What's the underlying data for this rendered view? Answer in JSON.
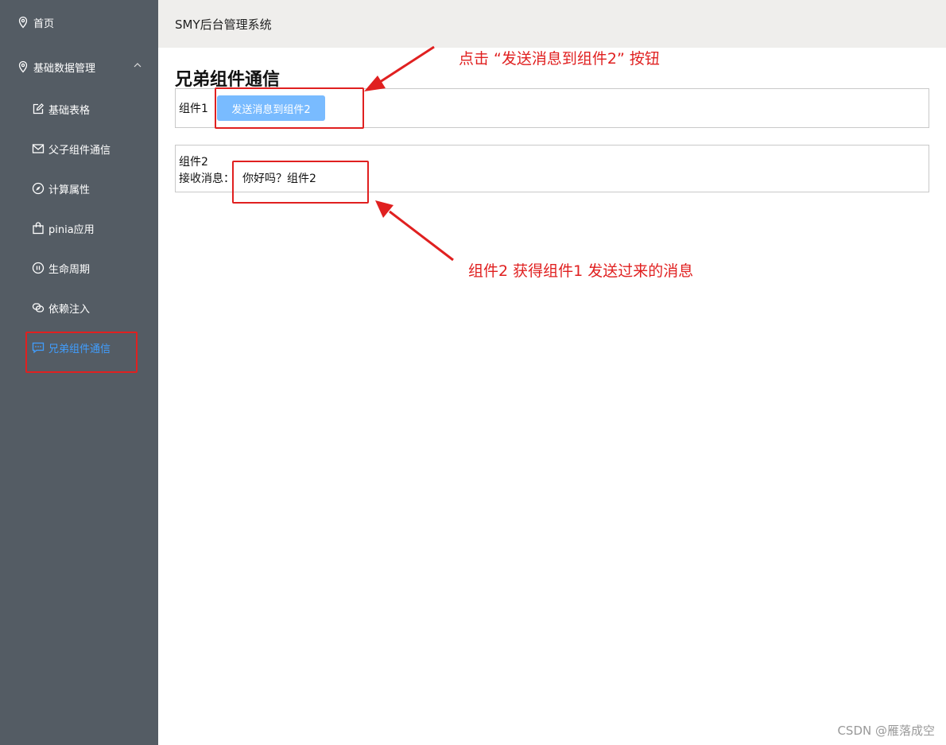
{
  "header": {
    "title": "SMY后台管理系统"
  },
  "sidebar": {
    "items": [
      {
        "label": "首页",
        "icon": "location-icon"
      },
      {
        "label": "基础数据管理",
        "icon": "location-icon",
        "expanded": true
      }
    ],
    "subitems": [
      {
        "label": "基础表格",
        "icon": "edit-icon"
      },
      {
        "label": "父子组件通信",
        "icon": "message-icon"
      },
      {
        "label": "计算属性",
        "icon": "compass-icon"
      },
      {
        "label": "pinia应用",
        "icon": "shopping-bag-icon"
      },
      {
        "label": "生命周期",
        "icon": "pause-icon"
      },
      {
        "label": "依赖注入",
        "icon": "link-icon"
      },
      {
        "label": "兄弟组件通信",
        "icon": "chat-dots-icon",
        "active": true
      }
    ]
  },
  "main": {
    "title": "兄弟组件通信",
    "component1": {
      "label": "组件1",
      "button_label": "发送消息到组件2"
    },
    "component2": {
      "label": "组件2",
      "receive_label": "接收消息：",
      "message": "你好吗？组件2"
    }
  },
  "annotations": {
    "top": "点击  “发送消息到组件2” 按钮",
    "bottom": "组件2 获得组件1 发送过来的消息"
  },
  "watermark": "CSDN @雁落成空",
  "colors": {
    "sidebar_bg": "#545c64",
    "active": "#409eff",
    "button_bg": "#79bbff",
    "header_bg": "#efeeec",
    "annotation": "#e02020"
  }
}
